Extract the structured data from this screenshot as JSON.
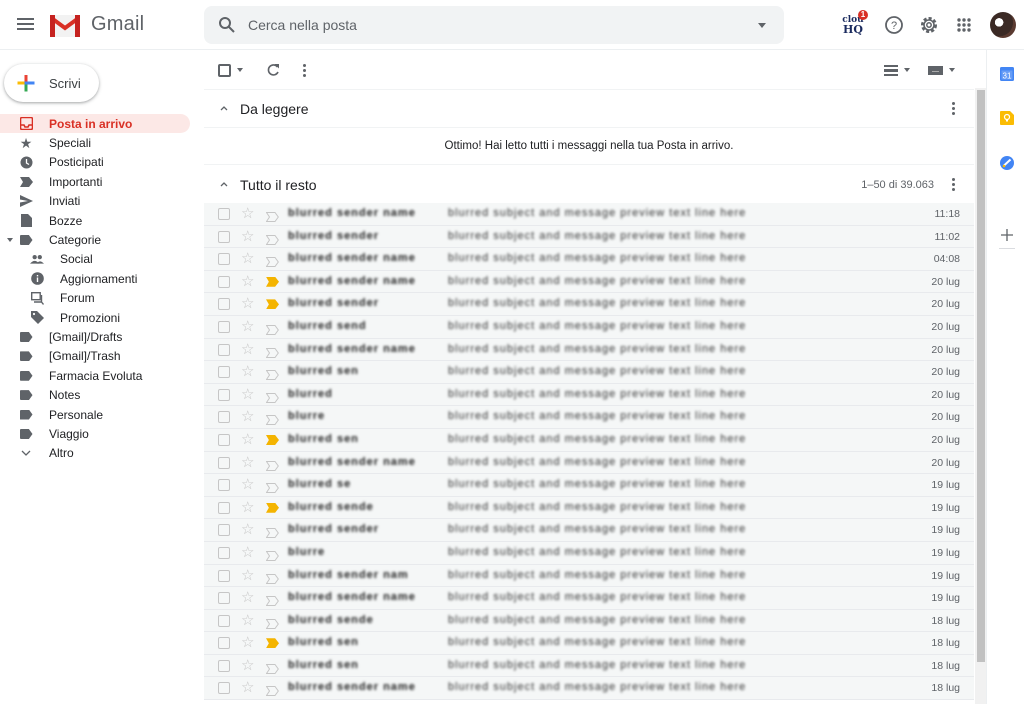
{
  "app": {
    "name": "Gmail"
  },
  "search": {
    "placeholder": "Cerca nella posta"
  },
  "header_icons": {
    "cloudhq_label_top": "clou",
    "cloudhq_label_bottom": "HQ",
    "cloudhq_badge": "1"
  },
  "compose": {
    "label": "Scrivi"
  },
  "sidebar": {
    "items": [
      {
        "label": "Posta in arrivo",
        "icon": "inbox-icon",
        "active": true
      },
      {
        "label": "Speciali",
        "icon": "star-icon"
      },
      {
        "label": "Posticipati",
        "icon": "clock-icon"
      },
      {
        "label": "Importanti",
        "icon": "important-icon"
      },
      {
        "label": "Inviati",
        "icon": "send-icon"
      },
      {
        "label": "Bozze",
        "icon": "draft-icon"
      },
      {
        "label": "Categorie",
        "icon": "label-icon",
        "expandable": true
      },
      {
        "label": "Social",
        "icon": "people-icon",
        "sub": true
      },
      {
        "label": "Aggiornamenti",
        "icon": "info-icon",
        "sub": true
      },
      {
        "label": "Forum",
        "icon": "forum-icon",
        "sub": true
      },
      {
        "label": "Promozioni",
        "icon": "tag-icon",
        "sub": true
      },
      {
        "label": "[Gmail]/Drafts",
        "icon": "label-icon"
      },
      {
        "label": "[Gmail]/Trash",
        "icon": "label-icon"
      },
      {
        "label": "Farmacia Evoluta",
        "icon": "label-icon"
      },
      {
        "label": "Notes",
        "icon": "label-icon"
      },
      {
        "label": "Personale",
        "icon": "label-icon"
      },
      {
        "label": "Viaggio",
        "icon": "label-icon"
      },
      {
        "label": "Altro",
        "icon": "chevron-down-icon"
      }
    ]
  },
  "sections": {
    "unread": {
      "title": "Da leggere",
      "empty_message": "Ottimo! Hai letto tutti i messaggi nella tua Posta in arrivo."
    },
    "rest": {
      "title": "Tutto il resto",
      "count": "1–50 di 39.063"
    }
  },
  "emails": [
    {
      "sender": "blurred sender name",
      "snippet": "blurred subject and message preview text line here",
      "date": "11:18",
      "important": false
    },
    {
      "sender": "blurred sender",
      "snippet": "blurred subject and message preview text line here",
      "date": "11:02",
      "important": false
    },
    {
      "sender": "blurred sender name",
      "snippet": "blurred subject and message preview text line here",
      "date": "04:08",
      "important": false
    },
    {
      "sender": "blurred sender name",
      "snippet": "blurred subject and message preview text line here",
      "date": "20 lug",
      "important": true
    },
    {
      "sender": "blurred sender",
      "snippet": "blurred subject and message preview text line here",
      "date": "20 lug",
      "important": true
    },
    {
      "sender": "blurred send",
      "snippet": "blurred subject and message preview text line here",
      "date": "20 lug",
      "important": false
    },
    {
      "sender": "blurred sender name",
      "snippet": "blurred subject and message preview text line here",
      "date": "20 lug",
      "important": false
    },
    {
      "sender": "blurred sen",
      "snippet": "blurred subject and message preview text line here",
      "date": "20 lug",
      "important": false
    },
    {
      "sender": "blurred",
      "snippet": "blurred subject and message preview text line here",
      "date": "20 lug",
      "important": false
    },
    {
      "sender": "blurre",
      "snippet": "blurred subject and message preview text line here",
      "date": "20 lug",
      "important": false
    },
    {
      "sender": "blurred sen",
      "snippet": "blurred subject and message preview text line here",
      "date": "20 lug",
      "important": true
    },
    {
      "sender": "blurred sender name",
      "snippet": "blurred subject and message preview text line here",
      "date": "20 lug",
      "important": false
    },
    {
      "sender": "blurred se",
      "snippet": "blurred subject and message preview text line here",
      "date": "19 lug",
      "important": false
    },
    {
      "sender": "blurred sende",
      "snippet": "blurred subject and message preview text line here",
      "date": "19 lug",
      "important": true
    },
    {
      "sender": "blurred sender",
      "snippet": "blurred subject and message preview text line here",
      "date": "19 lug",
      "important": false
    },
    {
      "sender": "blurre",
      "snippet": "blurred subject and message preview text line here",
      "date": "19 lug",
      "important": false
    },
    {
      "sender": "blurred sender nam",
      "snippet": "blurred subject and message preview text line here",
      "date": "19 lug",
      "important": false
    },
    {
      "sender": "blurred sender name",
      "snippet": "blurred subject and message preview text line here",
      "date": "19 lug",
      "important": false
    },
    {
      "sender": "blurred sende",
      "snippet": "blurred subject and message preview text line here",
      "date": "18 lug",
      "important": false
    },
    {
      "sender": "blurred sen",
      "snippet": "blurred subject and message preview text line here",
      "date": "18 lug",
      "important": true
    },
    {
      "sender": "blurred sen",
      "snippet": "blurred subject and message preview text line here",
      "date": "18 lug",
      "important": false
    },
    {
      "sender": "blurred sender name",
      "snippet": "blurred subject and message preview text line here",
      "date": "18 lug",
      "important": false
    }
  ],
  "right_panel": {
    "calendar_label": "31"
  },
  "colors": {
    "brand_red": "#d93025",
    "important_yellow": "#f4b400",
    "active_bg": "#fce8e6"
  }
}
